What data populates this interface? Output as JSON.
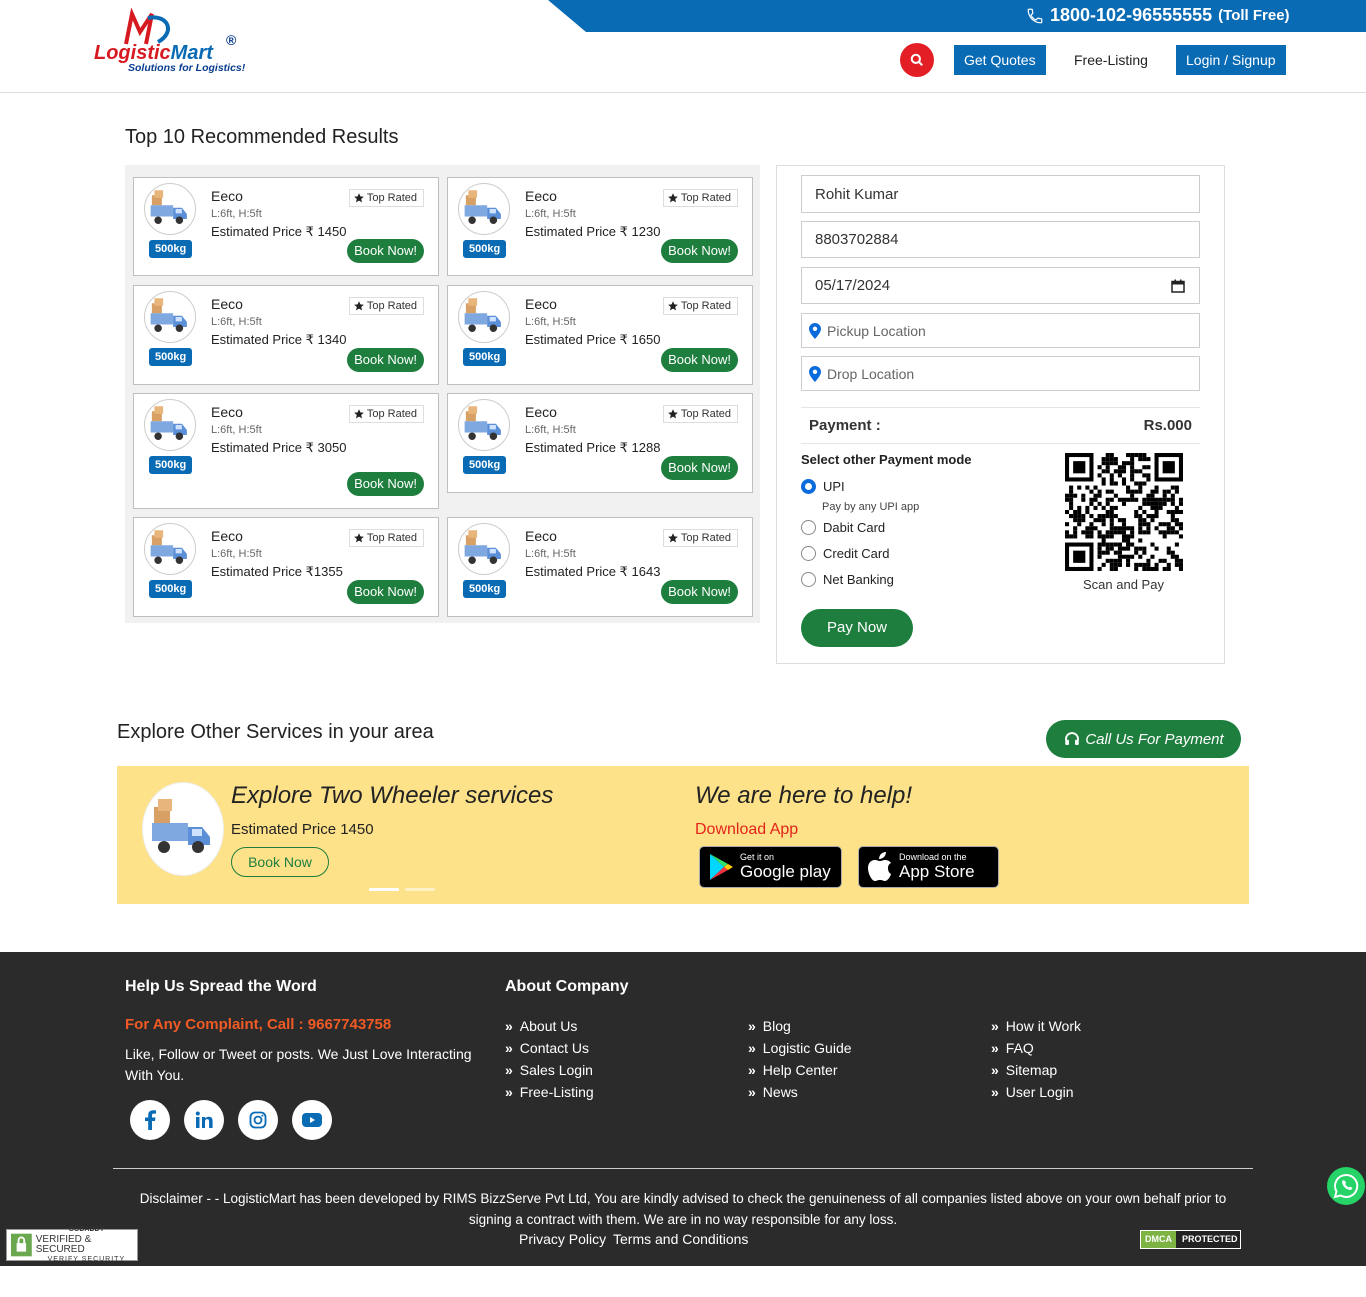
{
  "header": {
    "phone": "1800-102-96555555",
    "phone_suffix": "(Toll Free)",
    "logo_text_1": "Logistic",
    "logo_text_2": "Mart",
    "logo_reg": "®",
    "logo_tagline": "Solutions for Logistics!",
    "nav": {
      "quotes": "Get Quotes",
      "free_listing": "Free-Listing",
      "login": "Login / Signup"
    },
    "colors": {
      "brand_blue": "#0a6bb5",
      "brand_red": "#e31e24",
      "green": "#1e7e3e"
    }
  },
  "results": {
    "title": "Top 10 Recommended Results",
    "cards": [
      {
        "name": "Eeco",
        "dims": "L:6ft, H:5ft",
        "price_label": "Estimated Price ₹ 1450",
        "capacity": "500kg",
        "badge": "Top Rated",
        "button": "Book Now!"
      },
      {
        "name": "Eeco",
        "dims": "L:6ft, H:5ft",
        "price_label": "Estimated Price ₹ 1230",
        "capacity": "500kg",
        "badge": "Top Rated",
        "button": "Book Now!"
      },
      {
        "name": "Eeco",
        "dims": "L:6ft, H:5ft",
        "price_label": "Estimated Price ₹ 1340",
        "capacity": "500kg",
        "badge": "Top Rated",
        "button": "Book Now!"
      },
      {
        "name": "Eeco",
        "dims": "L:6ft, H:5ft",
        "price_label": "Estimated Price ₹ 1650",
        "capacity": "500kg",
        "badge": "Top Rated",
        "button": "Book Now!"
      },
      {
        "name": "Eeco",
        "dims": "L:6ft, H:5ft",
        "price_label": "Estimated Price ₹ 3050",
        "capacity": "500kg",
        "badge": "Top Rated",
        "button": "Book Now!"
      },
      {
        "name": "Eeco",
        "dims": "L:6ft, H:5ft",
        "price_label": "Estimated Price ₹ 1288",
        "capacity": "500kg",
        "badge": "Top Rated",
        "button": "Book Now!"
      },
      {
        "name": "Eeco",
        "dims": "L:6ft, H:5ft",
        "price_label": "Estimated Price ₹1355",
        "capacity": "500kg",
        "badge": "Top Rated",
        "button": "Book Now!"
      },
      {
        "name": "Eeco",
        "dims": "L:6ft, H:5ft",
        "price_label": "Estimated Price ₹ 1643",
        "capacity": "500kg",
        "badge": "Top Rated",
        "button": "Book Now!"
      }
    ]
  },
  "form": {
    "name_value": "Rohit Kumar",
    "phone_value": "8803702884",
    "date_value": "05/17/2024",
    "pickup_placeholder": "Pickup Location",
    "drop_placeholder": "Drop Location",
    "payment_label": "Payment :",
    "payment_amount": "Rs.000",
    "payment_mode_title": "Select other Payment mode",
    "options": [
      {
        "label": "UPI",
        "selected": true
      },
      {
        "label": "Dabit Card",
        "selected": false
      },
      {
        "label": "Credit Card",
        "selected": false
      },
      {
        "label": "Net Banking",
        "selected": false
      }
    ],
    "upi_sub": "Pay by any UPI app",
    "qr_caption": "Scan and Pay",
    "pay_button": "Pay Now"
  },
  "explore": {
    "title": "Explore Other Services in your area",
    "call_button": "Call Us For Payment",
    "banner_title": "Explore Two Wheeler services",
    "banner_price": "Estimated Price 1450",
    "banner_button": "Book Now",
    "help_title": "We are here to help!",
    "download_label": "Download App",
    "google_small": "Get it on",
    "google_big": "Google play",
    "apple_small": "Download on the",
    "apple_big": "App Store",
    "banner_bg": "#fde28a"
  },
  "footer": {
    "spread_title": "Help Us Spread the Word",
    "complaint": "For Any Complaint, Call : 9667743758",
    "follow_text": "Like, Follow or Tweet or posts. We Just Love Interacting With You.",
    "about_title": "About Company",
    "col1": [
      "About Us",
      "Contact Us",
      "Sales Login",
      "Free-Listing"
    ],
    "col2": [
      "Blog",
      "Logistic Guide",
      "Help Center",
      "News"
    ],
    "col3": [
      "How it Work",
      "FAQ",
      "Sitemap",
      "User Login"
    ],
    "disclaimer": "Disclaimer - - LogisticMart has been developed by RIMS BizzServe Pvt Ltd, You are kindly advised to check the genuineness of all companies listed above on your own behalf prior to signing a contract with them. We are in no way responsible for any loss.",
    "privacy": "Privacy Policy",
    "terms": "Terms and Conditions",
    "dmca_left": "DMCA",
    "dmca_right": "PROTECTED",
    "godaddy_line1": "GODADDY",
    "godaddy_line2": "VERIFIED & SECURED",
    "godaddy_line3": "VERIFY SECURITY",
    "social_icons": [
      "facebook-icon",
      "linkedin-icon",
      "instagram-icon",
      "youtube-icon"
    ]
  }
}
